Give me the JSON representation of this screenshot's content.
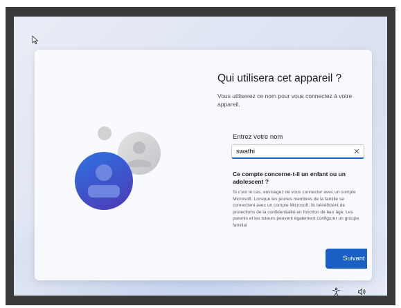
{
  "setup": {
    "title": "Qui utilisera cet appareil ?",
    "subtitle": "Vous utiliserez ce nom pour vous connectez à votre appareil.",
    "name_field": {
      "label": "Entrez votre nom",
      "value": "swathi"
    },
    "question": "Ce compte concerne-t-il un enfant ou un adolescent ?",
    "info": "Si c’est le cas, envisagez de vous connecter avec un compte Microsoft. Lorsque les jeunes membres de la famille se connectent avec un compte Microsoft, ils bénéficient de protections de la confidentialité en fonction de leur âge. Les parents et les tuteurs peuvent également configurer un groupe familial",
    "next_label": "Suivant"
  },
  "icons": {
    "cursor": "mouse-pointer-icon",
    "clear": "close-icon",
    "accessibility": "accessibility-icon",
    "volume": "volume-icon"
  },
  "colors": {
    "accent": "#1a60c4",
    "avatar_front": "#3b5fd0",
    "avatar_back": "#c9c9cc"
  }
}
